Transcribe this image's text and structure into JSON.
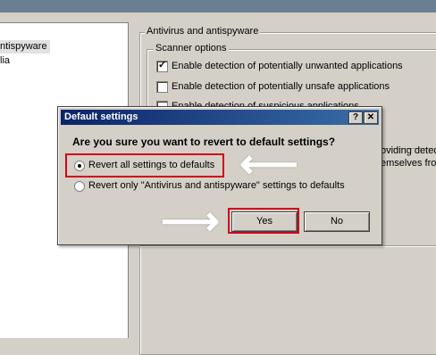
{
  "left_tree": {
    "items": [
      {
        "label": "ntispyware",
        "selected": true
      },
      {
        "label": "lia",
        "selected": false
      }
    ]
  },
  "settings": {
    "group_title": "Antivirus and antispyware",
    "scanner_options_title": "Scanner options",
    "options": [
      {
        "label": "Enable detection of potentially unwanted applications",
        "checked": true
      },
      {
        "label": "Enable detection of potentially unsafe applications",
        "checked": false
      }
    ],
    "partial_text": {
      "row3": "Enable detection of suspicious applications",
      "side_line1": "oviding detec",
      "side_line2": "emselves fron"
    }
  },
  "dialog": {
    "title": "Default settings",
    "help_label": "?",
    "close_label": "✕",
    "question": "Are you sure you want to revert to default settings?",
    "radio_all": "Revert all settings to defaults",
    "radio_only": "Revert only \"Antivirus and antispyware\" settings to defaults",
    "selected": "radio_all",
    "yes_label": "Yes",
    "no_label": "No"
  },
  "annotations": {
    "highlight_color": "#d0021b",
    "arrow_glyph": "⟵",
    "arrow_right_glyph": "⟶"
  }
}
